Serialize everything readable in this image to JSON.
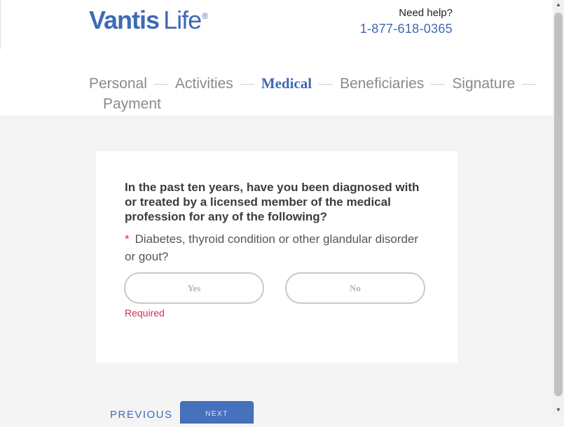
{
  "header": {
    "brand": "Vantis",
    "brand_life": "Life",
    "registered": "®",
    "help_label": "Need help?",
    "phone": "1-877-618-0365"
  },
  "steps": [
    {
      "label": "Personal",
      "active": false
    },
    {
      "label": "Activities",
      "active": false
    },
    {
      "label": "Medical",
      "active": true
    },
    {
      "label": "Beneficiaries",
      "active": false
    },
    {
      "label": "Signature",
      "active": false
    },
    {
      "label": "Payment",
      "active": false
    }
  ],
  "question": {
    "title": "In the past ten years, have you been diagnosed with or treated by a licensed member of the medical profession for any of the following?",
    "required_marker": "*",
    "item": "Diabetes, thyroid condition or other glandular disorder or gout?",
    "yes_label": "Yes",
    "no_label": "No",
    "error": "Required"
  },
  "navigation": {
    "previous_label": "PREVIOUS",
    "next_label": "NEXT"
  },
  "scrollbar": {
    "up_arrow": "▲",
    "down_arrow": "▼"
  },
  "colors": {
    "brand_blue": "#3f6ab5",
    "error_red": "#d32f55",
    "page_bg": "#f4f4f4"
  }
}
